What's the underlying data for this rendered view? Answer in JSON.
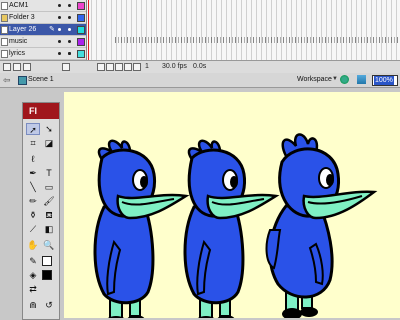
{
  "timeline": {
    "layers": [
      {
        "name": "ACM1",
        "color": "#ee44cc",
        "selected": false
      },
      {
        "name": "Folder 3",
        "color": "#3366ee",
        "selected": false
      },
      {
        "name": "Layer 26",
        "color": "#22dddd",
        "selected": true
      },
      {
        "name": "music",
        "color": "#aa22ee",
        "selected": false
      },
      {
        "name": "lyrics",
        "color": "#44dddd",
        "selected": false
      }
    ],
    "current_frame": "1",
    "fps": "30.0 fps",
    "time": "0.0s"
  },
  "scene_bar": {
    "scene_label": "Scene 1",
    "workspace_label": "Workspace",
    "zoom": "100%"
  },
  "tools": {
    "logo": "Fl",
    "fill_color": "#000000",
    "stroke_color": "#ffffff"
  },
  "stage": {
    "background": "#ffffcc",
    "characters": [
      "bird-left",
      "bird-middle",
      "bird-right"
    ]
  }
}
